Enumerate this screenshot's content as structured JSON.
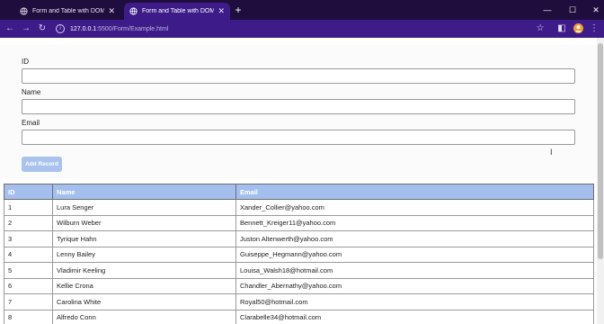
{
  "browser": {
    "tabs": [
      {
        "title": "Form and Table with DOM Ma",
        "active": false
      },
      {
        "title": "Form and Table with DOM Ma",
        "active": true
      }
    ],
    "url_host": "127.0.0.1",
    "url_rest": ":5500/Form/Example.html",
    "accent_color": "#3d1c8a"
  },
  "form": {
    "id_label": "ID",
    "name_label": "Name",
    "email_label": "Email",
    "submit_label": "Add Record"
  },
  "table": {
    "headers": [
      "ID",
      "Name",
      "Email"
    ],
    "rows": [
      [
        "1",
        "Lura Senger",
        "Xander_Collier@yahoo.com"
      ],
      [
        "2",
        "Wilburn Weber",
        "Bennett_Kreiger11@yahoo.com"
      ],
      [
        "3",
        "Tyrique Hahn",
        "Juston Altenwerth@yahoo.com"
      ],
      [
        "4",
        "Lenny Bailey",
        "Guiseppe_Hegmann@yahoo.com"
      ],
      [
        "5",
        "Vladimir Keeling",
        "Louisa_Walsh18@hotmail.com"
      ],
      [
        "6",
        "Kellie Crona",
        "Chandler_Abernathy@yahoo.com"
      ],
      [
        "7",
        "Carolina White",
        "Royal50@hotmail.com"
      ],
      [
        "8",
        "Alfredo Conn",
        "Clarabelle34@hotmail.com"
      ]
    ],
    "header_color": "#a4bfee"
  }
}
